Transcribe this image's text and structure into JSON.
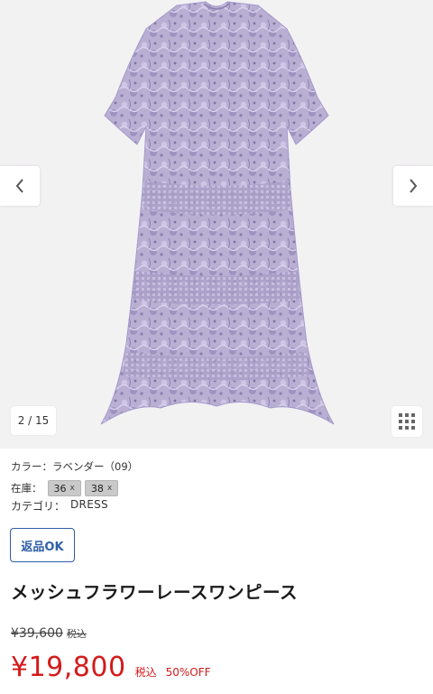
{
  "gallery": {
    "counter": "2 / 15",
    "prev_icon": "chevron-left-icon",
    "next_icon": "chevron-right-icon",
    "grid_icon": "grid-icon",
    "photo_description": "lavender lace dress"
  },
  "details": {
    "color": "カラー：ラベンダー（09）",
    "stock_label": "在庫：",
    "sizes": [
      {
        "label": "36",
        "mark": "x"
      },
      {
        "label": "38",
        "mark": "x"
      }
    ],
    "category_label": "カテゴリ：",
    "category_value": "DRESS",
    "return_badge": "返品OK"
  },
  "product": {
    "title": "メッシュフラワーレースワンピース",
    "original_price": "¥39,600",
    "original_tax": "税込",
    "sale_price": "¥19,800",
    "sale_tax": "税込",
    "discount": "50%OFF"
  },
  "colors": {
    "accent_blue": "#2f5fa8",
    "sale_red": "#d41a1a",
    "dress_lavender": "#b8aed4"
  }
}
